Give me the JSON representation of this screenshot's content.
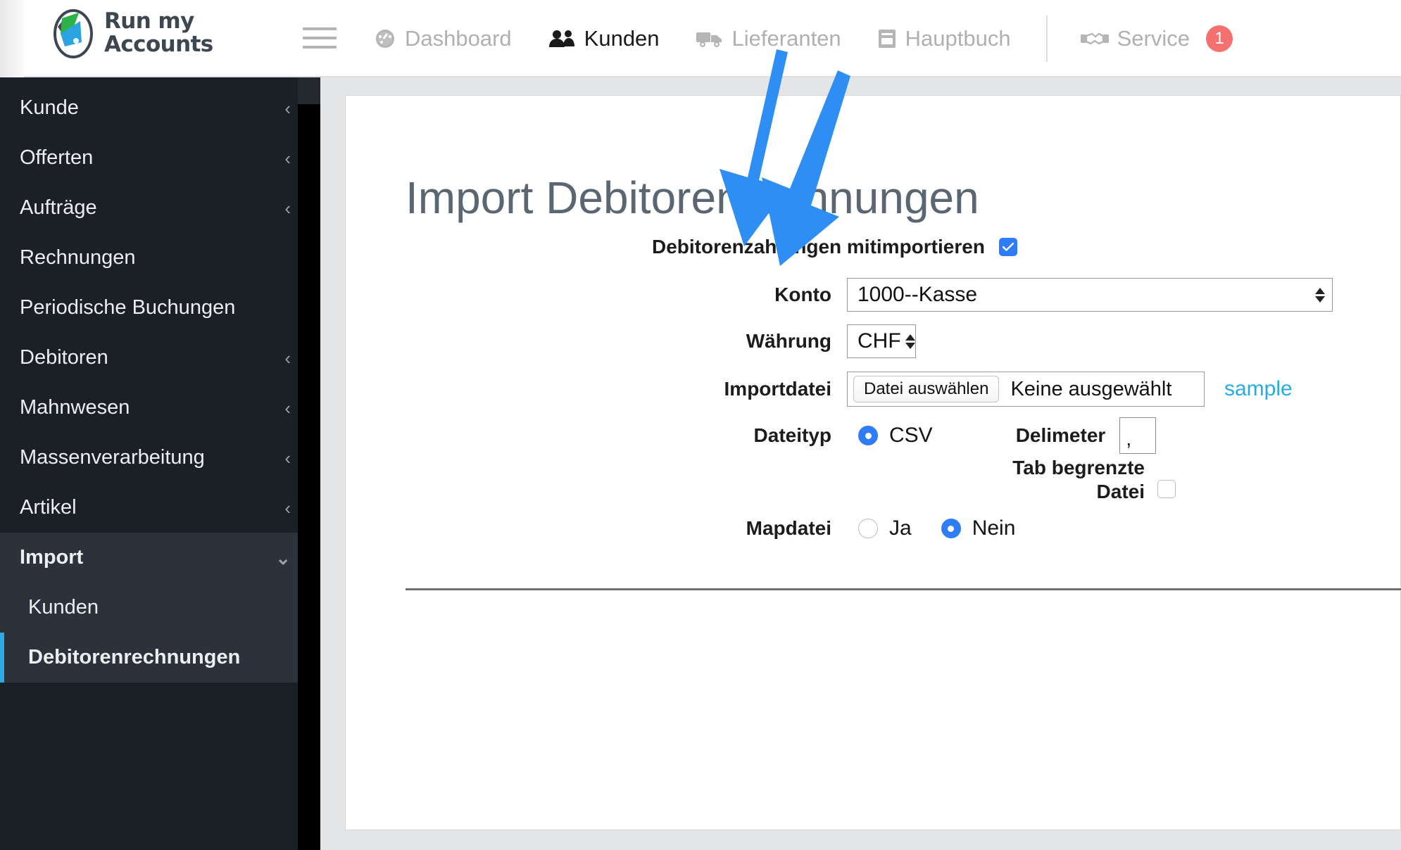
{
  "app": {
    "brand_line1": "Run my",
    "brand_line2": "Accounts"
  },
  "topnav": {
    "menu_toggle": "menu-toggle",
    "items": [
      {
        "label": "Dashboard",
        "icon": "dashboard-icon",
        "active": false
      },
      {
        "label": "Kunden",
        "icon": "users-icon",
        "active": true
      },
      {
        "label": "Lieferanten",
        "icon": "truck-icon",
        "active": false
      },
      {
        "label": "Hauptbuch",
        "icon": "book-icon",
        "active": false
      }
    ],
    "service": {
      "label": "Service",
      "icon": "handshake-icon",
      "badge": "1",
      "badge_color": "#f4716f"
    }
  },
  "sidebar": {
    "items": [
      {
        "label": "Kunde",
        "chevron": "‹"
      },
      {
        "label": "Offerten",
        "chevron": "‹"
      },
      {
        "label": "Aufträge",
        "chevron": "‹"
      },
      {
        "label": "Rechnungen",
        "chevron": ""
      },
      {
        "label": "Periodische Buchungen",
        "chevron": ""
      },
      {
        "label": "Debitoren",
        "chevron": "‹"
      },
      {
        "label": "Mahnwesen",
        "chevron": "‹"
      },
      {
        "label": "Massenverarbeitung",
        "chevron": "‹"
      },
      {
        "label": "Artikel",
        "chevron": "‹"
      }
    ],
    "section": {
      "label": "Import",
      "chevron": "⌄"
    },
    "subitems": [
      {
        "label": "Kunden",
        "active": false
      },
      {
        "label": "Debitorenrechnungen",
        "active": true
      }
    ],
    "accent_color": "#2eaae2"
  },
  "main": {
    "title": "Import Debitorenrechnungen",
    "fields": {
      "mitimportieren": {
        "label": "Debitorenzahlungen mitimportieren",
        "checked": true
      },
      "konto": {
        "label": "Konto",
        "value": "1000--Kasse"
      },
      "waehrung": {
        "label": "Währung",
        "value": "CHF"
      },
      "importdatei": {
        "label": "Importdatei",
        "button": "Datei auswählen",
        "filename": "Keine ausgewählt",
        "sample_link": "sample"
      },
      "dateityp": {
        "label": "Dateityp",
        "option_csv": "CSV",
        "csv_selected": true
      },
      "delimeter": {
        "label": "Delimeter",
        "value": ","
      },
      "tab_begrenzte": {
        "label_line1": "Tab begrenzte",
        "label_line2": "Datei",
        "checked": false
      },
      "mapdatei": {
        "label": "Mapdatei",
        "option_ja": "Ja",
        "option_nein": "Nein",
        "selected": "Nein"
      }
    }
  },
  "colors": {
    "accent_blue": "#2e7df6",
    "link_blue": "#29abe2",
    "sidebar_bg": "#1b2026",
    "sidebar_section_bg": "#2b323b",
    "title_gray": "#5a6672",
    "arrow_blue": "#2f8ef4"
  }
}
